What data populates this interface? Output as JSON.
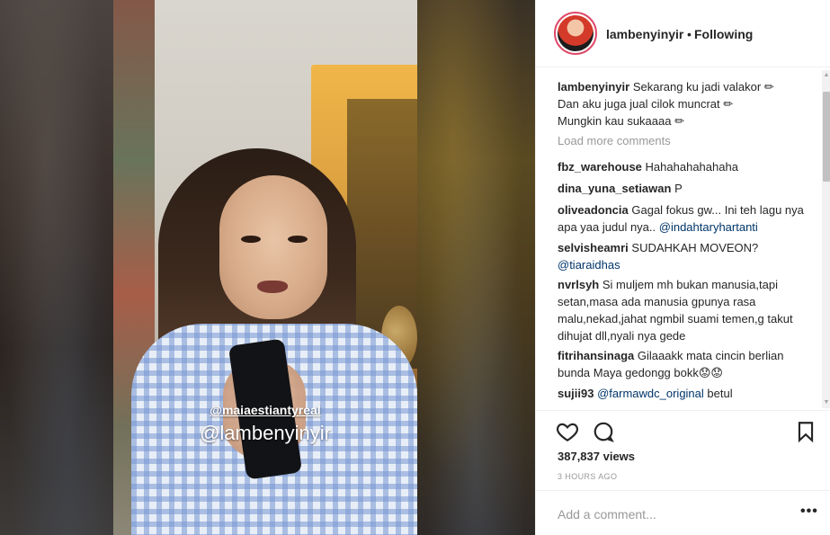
{
  "post": {
    "overlay_tag_small": "@maiaestiantyreal",
    "overlay_tag_big": "@lambenyinyir"
  },
  "header": {
    "username": "lambenyinyir",
    "separator": "•",
    "follow_status": "Following"
  },
  "caption": {
    "username": "lambenyinyir",
    "line1": "Sekarang ku jadi valakor ✏",
    "line2": "Dan aku juga jual cilok muncrat ✏",
    "line3": "Mungkin kau sukaaaa ✏"
  },
  "load_more": "Load more comments",
  "comments": [
    {
      "user": "fbz_warehouse",
      "text": "Hahahahahahaha"
    },
    {
      "user": "dina_yuna_setiawan",
      "text": "P"
    },
    {
      "user": "oliveadoncia",
      "text": "Gagal fokus gw... Ini teh lagu nya apa yaa judul nya..",
      "mention": "@indahtaryhartanti"
    },
    {
      "user": "selvisheamri",
      "text": "SUDAHKAH MOVEON?",
      "mention": "@tiaraidhas"
    },
    {
      "user": "nvrlsyh",
      "text": "Si muljem mh bukan manusia,tapi setan,masa ada manusia gpunya rasa malu,nekad,jahat ngmbil suami temen,g takut dihujat dll,nyali nya gede"
    },
    {
      "user": "fitrihansinaga",
      "text": "Gilaaakk mata cincin berlian bunda Maya gedongg bokk😟😟"
    },
    {
      "user": "sujii93",
      "mention": "@farmawdc_original",
      "text": "betul"
    }
  ],
  "actions": {
    "icons": [
      "heart-icon",
      "comment-icon",
      "bookmark-icon"
    ],
    "views": "387,837 views",
    "timestamp": "3 HOURS AGO"
  },
  "add_comment": {
    "placeholder": "Add a comment...",
    "more": "•••"
  },
  "colors": {
    "text": "#262626",
    "muted": "#999999",
    "mention": "#003569",
    "border": "#efefef",
    "avatar_ring": "#e04a6a"
  }
}
